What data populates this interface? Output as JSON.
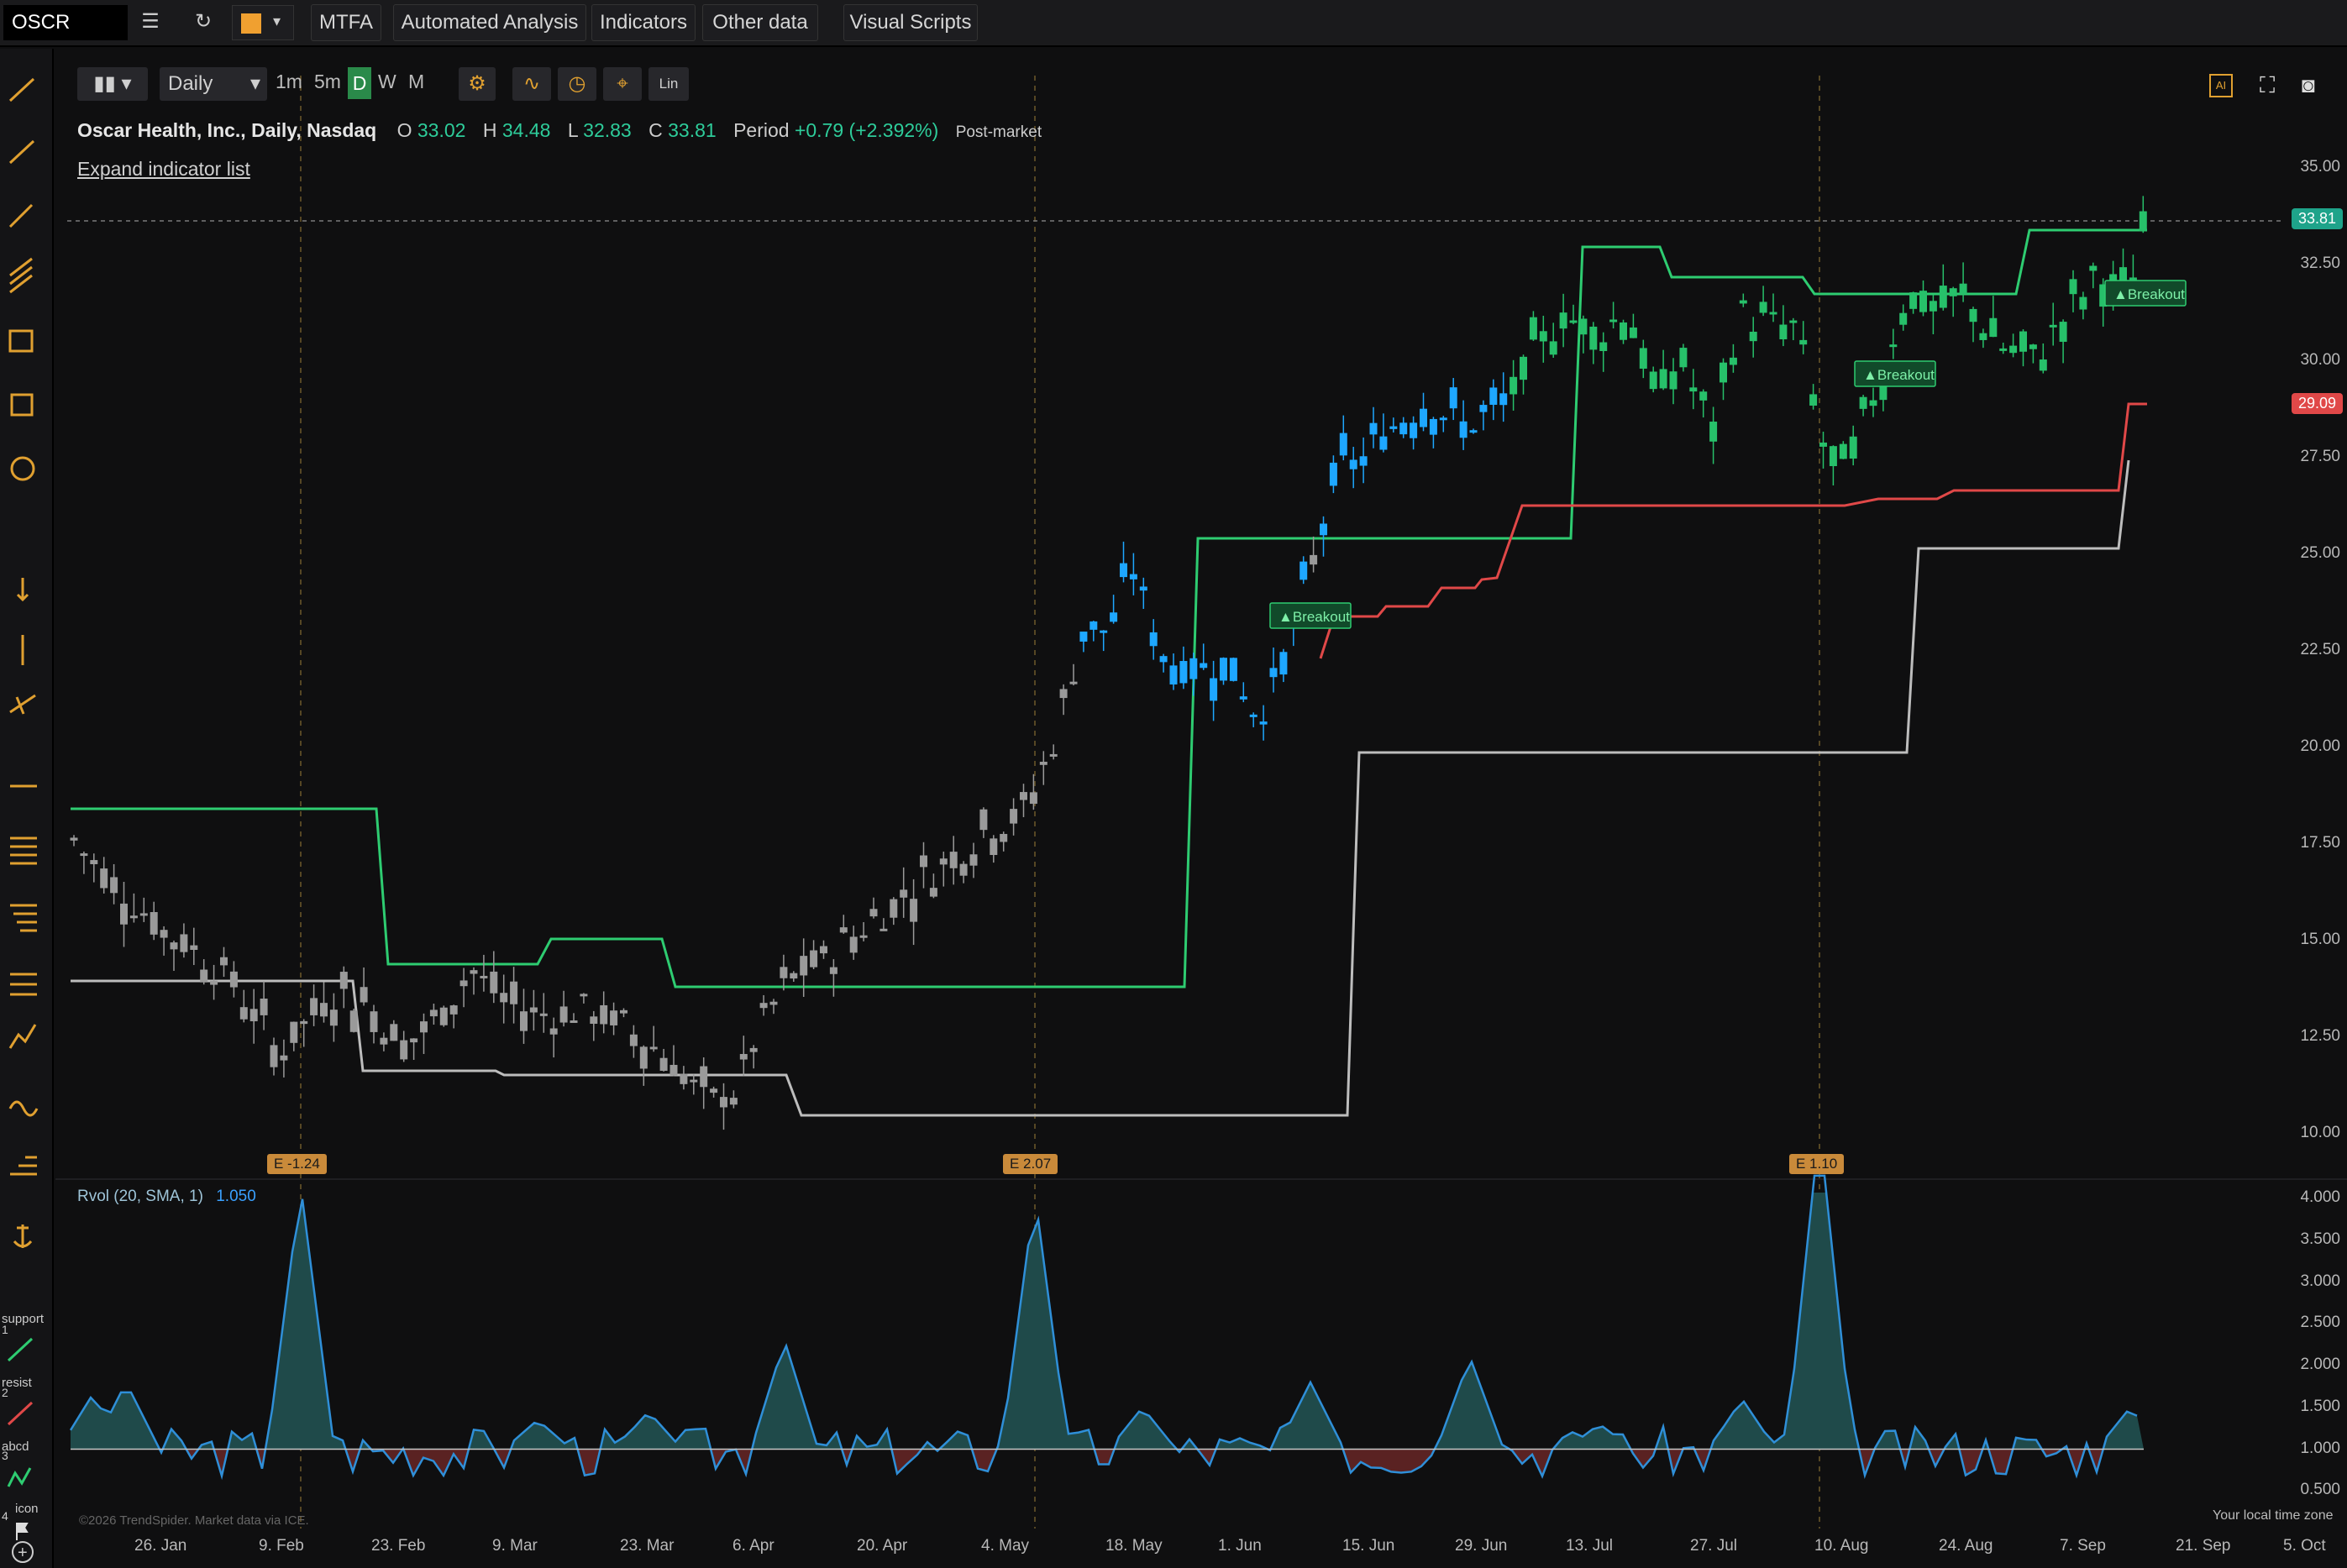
{
  "toolbar": {
    "ticker": "OSCR",
    "buttons": [
      "MTFA",
      "Automated Analysis",
      "Indicators",
      "Other data",
      "Visual Scripts"
    ]
  },
  "subtoolbar": {
    "interval": "Daily",
    "timeframes": [
      "1m",
      "5m",
      "D",
      "W",
      "M"
    ],
    "active_timeframe": "D",
    "lin": "Lin"
  },
  "header": {
    "company": "Oscar Health, Inc., Daily, Nasdaq",
    "open_label": "O",
    "open": "33.02",
    "high_label": "H",
    "high": "34.48",
    "low_label": "L",
    "low": "32.83",
    "close_label": "C",
    "close": "33.81",
    "period_label": "Period",
    "period": "+0.79 (+2.392%)",
    "session": "Post-market",
    "expand": "Expand indicator list"
  },
  "price_axis": {
    "ticks": [
      "35.00",
      "32.50",
      "30.00",
      "27.50",
      "25.00",
      "22.50",
      "20.00",
      "17.50",
      "15.00",
      "12.50",
      "10.00"
    ],
    "last_price": "33.81",
    "red_level": "29.09"
  },
  "volume_pane": {
    "title": "Rvol (20, SMA, 1)",
    "value": "1.050",
    "ticks": [
      "4.000",
      "3.500",
      "3.000",
      "2.500",
      "2.000",
      "1.500",
      "1.000",
      "0.500"
    ]
  },
  "time_axis": [
    "26. Jan",
    "9. Feb",
    "23. Feb",
    "9. Mar",
    "23. Mar",
    "6. Apr",
    "20. Apr",
    "4. May",
    "18. May",
    "1. Jun",
    "15. Jun",
    "29. Jun",
    "13. Jul",
    "27. Jul",
    "10. Aug",
    "24. Aug",
    "7. Sep",
    "21. Sep",
    "5. Oct"
  ],
  "earnings": [
    "E -1.24",
    "E 2.07",
    "E 1.10"
  ],
  "signals": [
    "Breakout",
    "Breakout",
    "Breakout"
  ],
  "footer": {
    "copyright": "©2026 TrendSpider. Market data via ICE.",
    "timezone": "Your local time zone"
  },
  "sidebar_labels": {
    "support": "support",
    "resist": "resist",
    "abcd": "abcd",
    "icon": "icon"
  },
  "colors": {
    "up": "#27c06a",
    "strong": "#1ea7ff",
    "neutral": "#9a9a9a",
    "red": "#e04848",
    "accent": "#f0a030"
  }
}
